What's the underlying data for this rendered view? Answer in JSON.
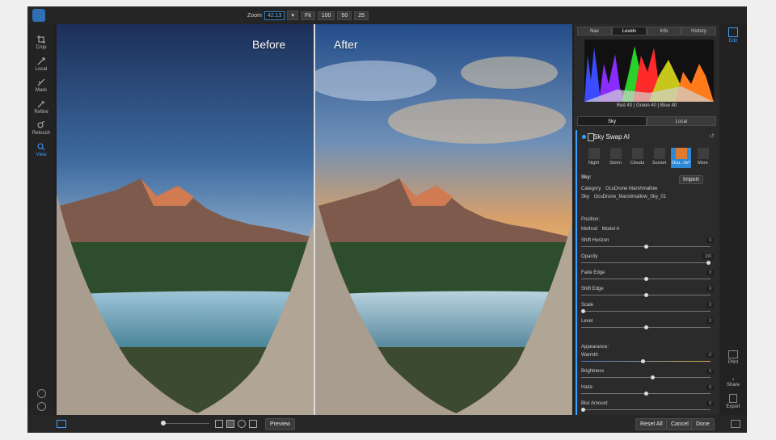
{
  "top": {
    "zoom_label": "Zoom",
    "zoom_value": "42.13",
    "zoom_presets": [
      "Fit",
      "100",
      "50",
      "25"
    ]
  },
  "tools": [
    {
      "label": "Crop",
      "icon": "crop-icon"
    },
    {
      "label": "Local",
      "icon": "local-icon"
    },
    {
      "label": "Mask",
      "icon": "mask-icon"
    },
    {
      "label": "Refine",
      "icon": "refine-icon"
    },
    {
      "label": "Retouch",
      "icon": "retouch-icon"
    },
    {
      "label": "View",
      "icon": "view-icon"
    }
  ],
  "canvas": {
    "before_label": "Before",
    "after_label": "After"
  },
  "panel": {
    "tabs": [
      "Nav",
      "Levels",
      "Info",
      "History"
    ],
    "histogram_readout": "Red 40 | Green 40 | Blue 40",
    "sky_tabs": [
      "Sky",
      "Local"
    ],
    "module_title": "Sky Swap AI",
    "sky_options": [
      "Night",
      "Storm",
      "Clouds",
      "Sunset",
      "Ocu...he*",
      "More"
    ],
    "sky_section": "Sky:",
    "import_label": "Import",
    "category_label": "Category",
    "category_value": "OcuDrone Marshmallow",
    "sky_label": "Sky",
    "sky_value": "OcuDrone_Marshmallow_Sky_01",
    "position_label": "Position:",
    "method_label": "Method",
    "method_value": "Model A",
    "sliders": [
      {
        "label": "Shift Horizon",
        "value": "0",
        "pos": 0.5
      },
      {
        "label": "Opacity",
        "value": "100",
        "pos": 1.0
      },
      {
        "label": "Fade Edge",
        "value": "0",
        "pos": 0.5
      },
      {
        "label": "Shift Edge",
        "value": "0",
        "pos": 0.5
      },
      {
        "label": "Scale",
        "value": "0",
        "pos": 0.0
      },
      {
        "label": "Level",
        "value": "0",
        "pos": 0.5
      }
    ],
    "appearance_label": "Appearance:",
    "appearance_sliders": [
      {
        "label": "Warmth",
        "value": "-2",
        "pos": 0.48
      },
      {
        "label": "Brightness",
        "value": "5",
        "pos": 0.55
      },
      {
        "label": "Haze",
        "value": "0",
        "pos": 0.5
      },
      {
        "label": "Blur Amount",
        "value": "0",
        "pos": 0.0
      }
    ]
  },
  "right_rail": {
    "edit_label": "Edit",
    "print_label": "Print",
    "share_label": "Share",
    "export_label": "Export"
  },
  "bottom": {
    "preview_label": "Preview",
    "reset_label": "Reset All",
    "cancel_label": "Cancel",
    "done_label": "Done"
  }
}
